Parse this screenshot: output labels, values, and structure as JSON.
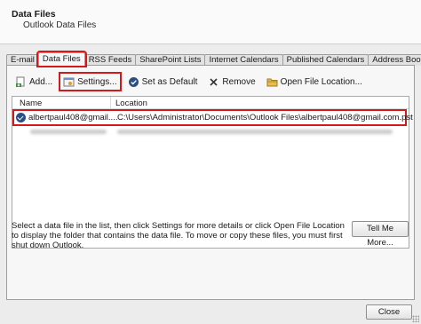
{
  "header": {
    "title": "Data Files",
    "subtitle": "Outlook Data Files"
  },
  "tabs": [
    {
      "label": "E-mail",
      "active": false
    },
    {
      "label": "Data Files",
      "active": true
    },
    {
      "label": "RSS Feeds",
      "active": false
    },
    {
      "label": "SharePoint Lists",
      "active": false
    },
    {
      "label": "Internet Calendars",
      "active": false
    },
    {
      "label": "Published Calendars",
      "active": false
    },
    {
      "label": "Address Books",
      "active": false
    }
  ],
  "toolbar": {
    "add_label": "Add...",
    "settings_label": "Settings...",
    "set_default_label": "Set as Default",
    "remove_label": "Remove",
    "open_location_label": "Open File Location..."
  },
  "list": {
    "col_name": "Name",
    "col_location": "Location",
    "rows": [
      {
        "name": "albertpaul408@gmail....",
        "location": "C:\\Users\\Administrator\\Documents\\Outlook Files\\albertpaul408@gmail.com.pst",
        "is_default": true
      }
    ]
  },
  "hint": "Select a data file in the list, then click Settings for more details or click Open File Location to display the folder that contains the data file. To move or copy these files, you must first shut down Outlook.",
  "buttons": {
    "tell_me_more": "Tell Me More...",
    "close": "Close"
  },
  "colors": {
    "highlight": "#d21a1a",
    "default_check": "#2a4f86"
  }
}
